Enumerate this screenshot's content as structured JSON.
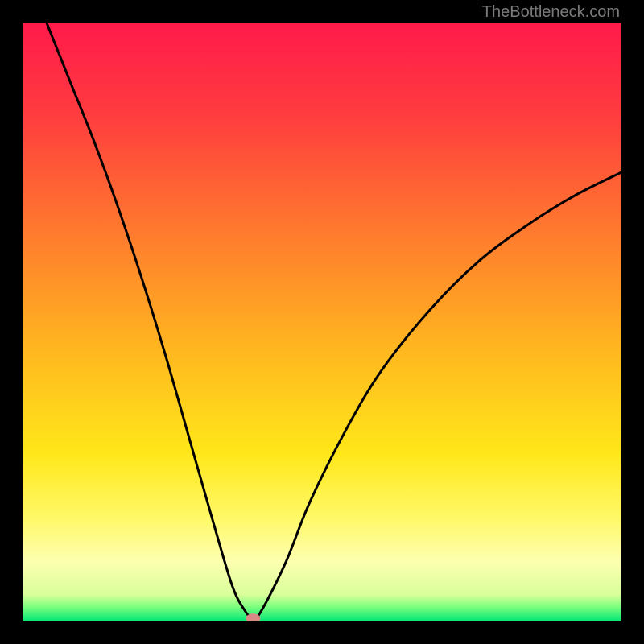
{
  "watermark": "TheBottleneck.com",
  "chart_data": {
    "type": "line",
    "title": "",
    "xlabel": "",
    "ylabel": "",
    "xlim": [
      0,
      100
    ],
    "ylim": [
      0,
      100
    ],
    "gradient_stops": [
      {
        "offset": 0.0,
        "color": "#ff1a4b"
      },
      {
        "offset": 0.15,
        "color": "#ff3b3f"
      },
      {
        "offset": 0.35,
        "color": "#ff7a2e"
      },
      {
        "offset": 0.55,
        "color": "#ffb81f"
      },
      {
        "offset": 0.72,
        "color": "#ffe71a"
      },
      {
        "offset": 0.83,
        "color": "#fff96a"
      },
      {
        "offset": 0.9,
        "color": "#fdffb0"
      },
      {
        "offset": 0.955,
        "color": "#d9ff9a"
      },
      {
        "offset": 0.975,
        "color": "#7eff7e"
      },
      {
        "offset": 1.0,
        "color": "#00e676"
      }
    ],
    "series": [
      {
        "name": "bottleneck-curve",
        "x": [
          4,
          8,
          12,
          16,
          20,
          24,
          28,
          32,
          35,
          37,
          38.5,
          40,
          44,
          48,
          54,
          60,
          68,
          76,
          84,
          92,
          100
        ],
        "values": [
          100,
          90,
          80,
          69,
          57,
          44,
          30,
          16,
          6,
          2,
          0.5,
          2,
          10,
          20,
          32,
          42,
          52,
          60,
          66,
          71,
          75
        ]
      }
    ],
    "marker": {
      "x": 38.5,
      "y": 0.5,
      "color": "#d98a86"
    }
  }
}
